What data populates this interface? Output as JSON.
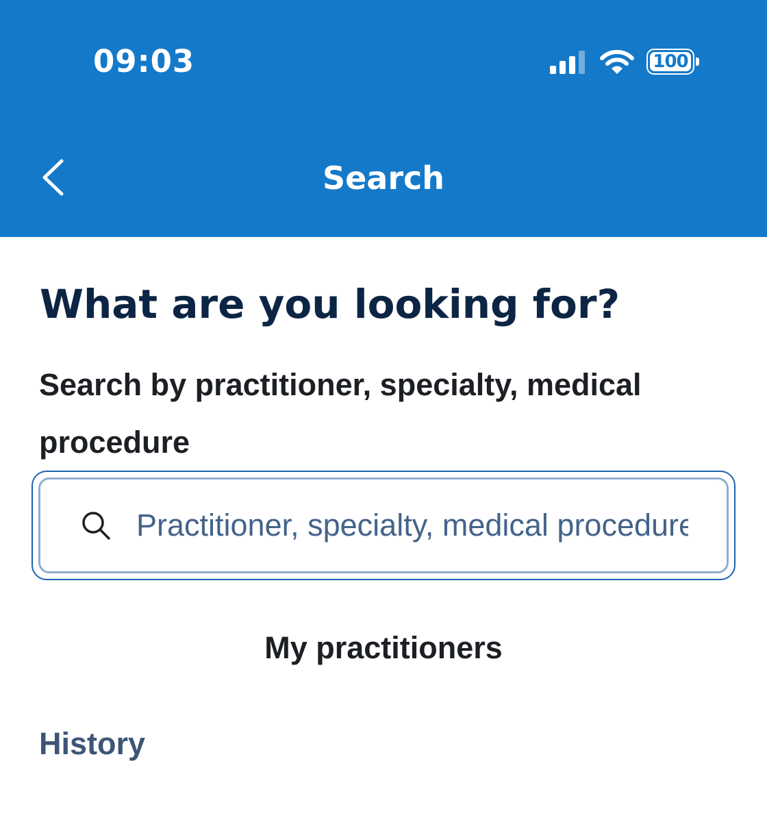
{
  "status_bar": {
    "time": "09:03",
    "battery_level": "100",
    "icons": [
      "signal-icon",
      "wifi-icon",
      "battery-icon"
    ]
  },
  "nav": {
    "back_icon": "chevron-left-icon",
    "title": "Search"
  },
  "main": {
    "heading": "What are you looking for?",
    "search_label": "Search by practitioner, specialty, medical procedure",
    "search": {
      "icon": "search-icon",
      "placeholder": "Practitioner, specialty, medical procedure",
      "value": ""
    },
    "my_practitioners_label": "My practitioners",
    "history_label": "History"
  },
  "colors": {
    "header_bg": "#1479C9",
    "heading_text": "#0D2544",
    "field_border": "#1A63AF",
    "placeholder_text": "#44638A",
    "history_text": "#3E5676"
  }
}
